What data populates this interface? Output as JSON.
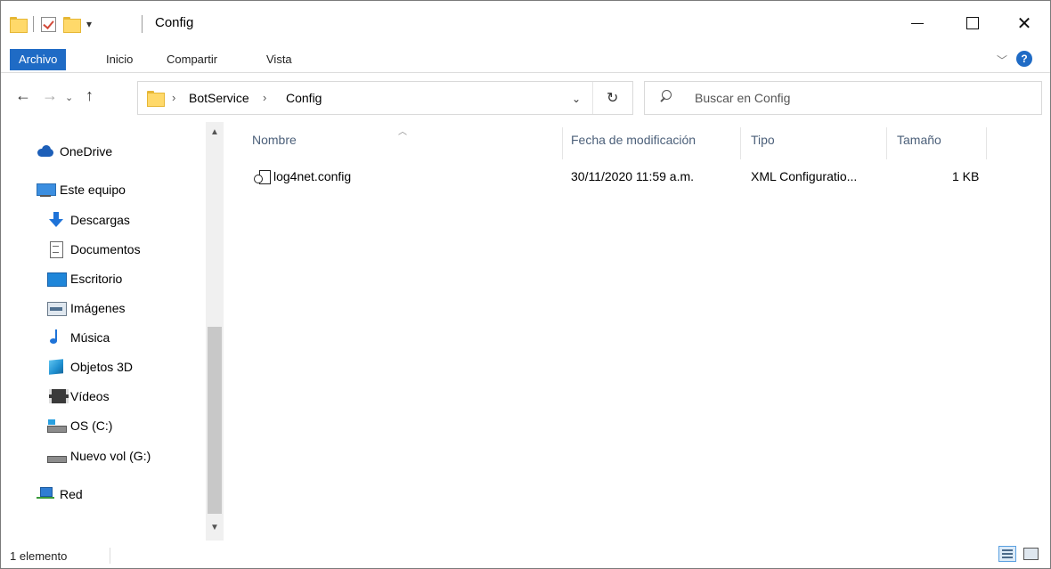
{
  "window": {
    "title": "Config",
    "controls": {
      "minimize": "Minimizar",
      "maximize": "Maximizar",
      "close": "Cerrar"
    }
  },
  "ribbon": {
    "tabs": [
      {
        "label": "Archivo",
        "active": true
      },
      {
        "label": "Inicio"
      },
      {
        "label": "Compartir"
      },
      {
        "label": "Vista"
      }
    ],
    "help_label": "?"
  },
  "address": {
    "breadcrumbs": [
      "BotService",
      "Config"
    ],
    "separator": "›"
  },
  "search": {
    "placeholder": "Buscar en Config",
    "value": ""
  },
  "nav_pane": {
    "items": [
      {
        "label": "OneDrive",
        "icon": "onedrive-icon"
      },
      {
        "label": "Este equipo",
        "icon": "computer-icon"
      },
      {
        "label": "Descargas",
        "icon": "downloads-icon"
      },
      {
        "label": "Documentos",
        "icon": "documents-icon"
      },
      {
        "label": "Escritorio",
        "icon": "desktop-icon"
      },
      {
        "label": "Imágenes",
        "icon": "pictures-icon"
      },
      {
        "label": "Música",
        "icon": "music-icon"
      },
      {
        "label": "Objetos 3D",
        "icon": "3d-objects-icon"
      },
      {
        "label": "Vídeos",
        "icon": "videos-icon"
      },
      {
        "label": "OS (C:)",
        "icon": "system-drive-icon"
      },
      {
        "label": "Nuevo vol (G:)",
        "icon": "drive-icon"
      },
      {
        "label": "Red",
        "icon": "network-icon"
      }
    ]
  },
  "file_list": {
    "columns": [
      "Nombre",
      "Fecha de modificación",
      "Tipo",
      "Tamaño"
    ],
    "rows": [
      {
        "name": "log4net.config",
        "modified": "30/11/2020 11:59 a.m.",
        "type": "XML Configuratio...",
        "size": "1 KB"
      }
    ]
  },
  "status_bar": {
    "item_count": "1 elemento"
  },
  "colors": {
    "file_tab": "#1f6bc5",
    "column_header_text": "#4c607a",
    "folder": "#ffd96a"
  }
}
